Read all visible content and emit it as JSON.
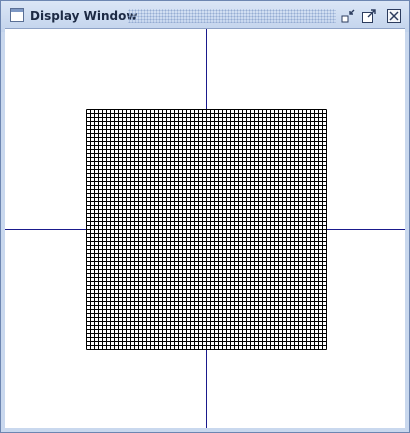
{
  "window": {
    "title": "Display Window",
    "icon": "window-app-icon"
  },
  "titlebar_buttons": [
    {
      "name": "minimize-icon"
    },
    {
      "name": "maximize-icon"
    },
    {
      "name": "close-icon"
    }
  ],
  "canvas": {
    "grid_cells_per_side": 60,
    "axis_color": "#1a1a8c",
    "grid_color": "#000000",
    "background": "#ffffff"
  }
}
